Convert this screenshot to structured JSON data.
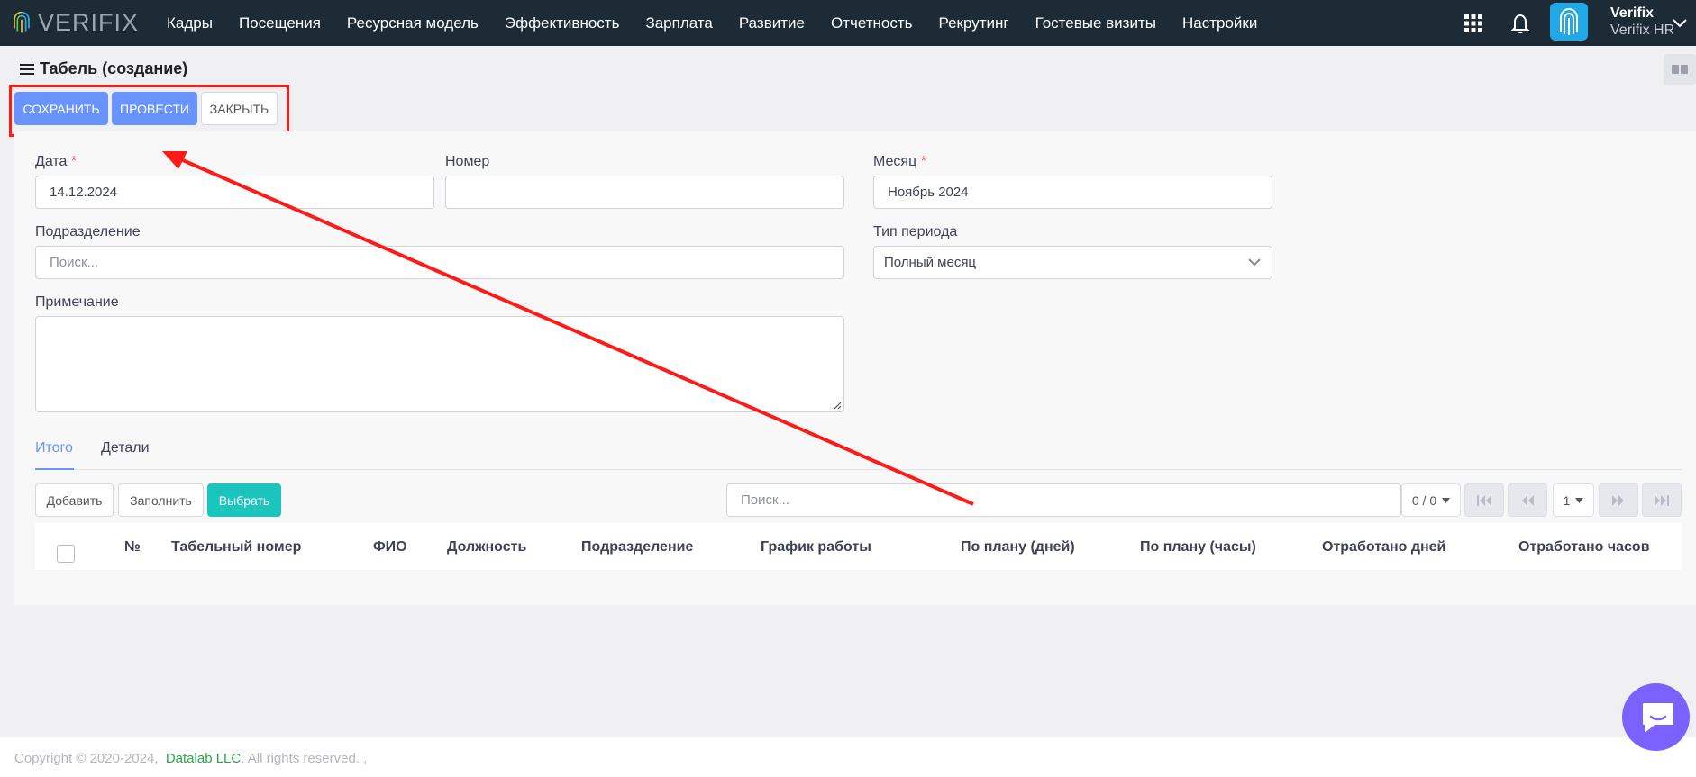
{
  "header": {
    "logo_text": "VERIFIX",
    "nav": [
      "Кадры",
      "Посещения",
      "Ресурсная модель",
      "Эффективность",
      "Зарплата",
      "Развитие",
      "Отчетность",
      "Рекрутинг",
      "Гостевые визиты",
      "Настройки"
    ],
    "user_name": "Verifix",
    "user_org": "Verifix HR"
  },
  "page": {
    "title": "Табель (создание)"
  },
  "toolbar": {
    "save": "СОХРАНИТЬ",
    "post": "ПРОВЕСТИ",
    "close": "ЗАКРЫТЬ"
  },
  "form": {
    "date_label": "Дата",
    "date_value": "14.12.2024",
    "number_label": "Номер",
    "number_value": "",
    "month_label": "Месяц",
    "month_value": "Ноябрь 2024",
    "division_label": "Подразделение",
    "division_placeholder": "Поиск...",
    "period_label": "Тип периода",
    "period_value": "Полный месяц",
    "note_label": "Примечание",
    "required_mark": "*"
  },
  "tabs": [
    "Итого",
    "Детали"
  ],
  "table_toolbar": {
    "add": "Добавить",
    "fill": "Заполнить",
    "select": "Выбрать",
    "search_placeholder": "Поиск...",
    "count": "0 / 0",
    "page": "1"
  },
  "table": {
    "columns": [
      "№",
      "Табельный номер",
      "ФИО",
      "Должность",
      "Подразделение",
      "График работы",
      "По плану (дней)",
      "По плану (часы)",
      "Отработано дней",
      "Отработано часов"
    ]
  },
  "footer": {
    "copyright": "Copyright © 2020-2024,",
    "company": "Datalab LLC",
    "rights": ". All rights reserved. ,"
  },
  "colors": {
    "topbar": "#1c2b36",
    "primary": "#6993ff",
    "teal": "#1bc5bd",
    "annotation": "#ff1a1a"
  }
}
